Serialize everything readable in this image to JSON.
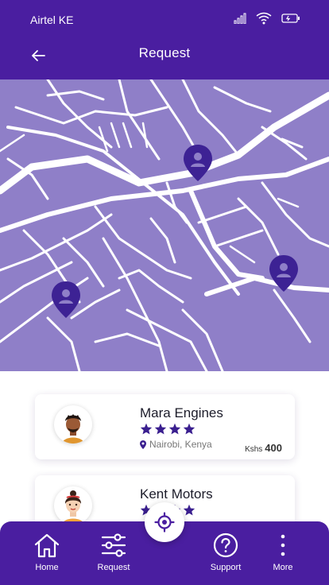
{
  "status_bar": {
    "carrier": "Airtel KE",
    "icons": [
      "signal-icon",
      "wifi-icon",
      "battery-icon"
    ]
  },
  "header": {
    "title": "Request",
    "back_icon": "back-arrow-icon"
  },
  "map": {
    "background_color": "#8f7fc8",
    "road_color": "#ffffff",
    "pin_color": "#3d2294",
    "pins": [
      "location-pin-icon",
      "location-pin-icon",
      "location-pin-icon"
    ]
  },
  "providers": [
    {
      "name": "Mara Engines",
      "rating": 4,
      "location": "Nairobi, Kenya",
      "price_currency": "Kshs",
      "price": "400"
    },
    {
      "name": "Kent Motors",
      "rating": 4
    }
  ],
  "bottom_nav": {
    "items": [
      {
        "label": "Home",
        "icon": "home-icon"
      },
      {
        "label": "Request",
        "icon": "sliders-icon"
      },
      {
        "label": "Support",
        "icon": "help-circle-icon"
      },
      {
        "label": "More",
        "icon": "more-vertical-icon"
      }
    ],
    "center_button_icon": "locate-icon"
  },
  "colors": {
    "primary": "#4a1ea0",
    "star": "#3a1f8f"
  }
}
